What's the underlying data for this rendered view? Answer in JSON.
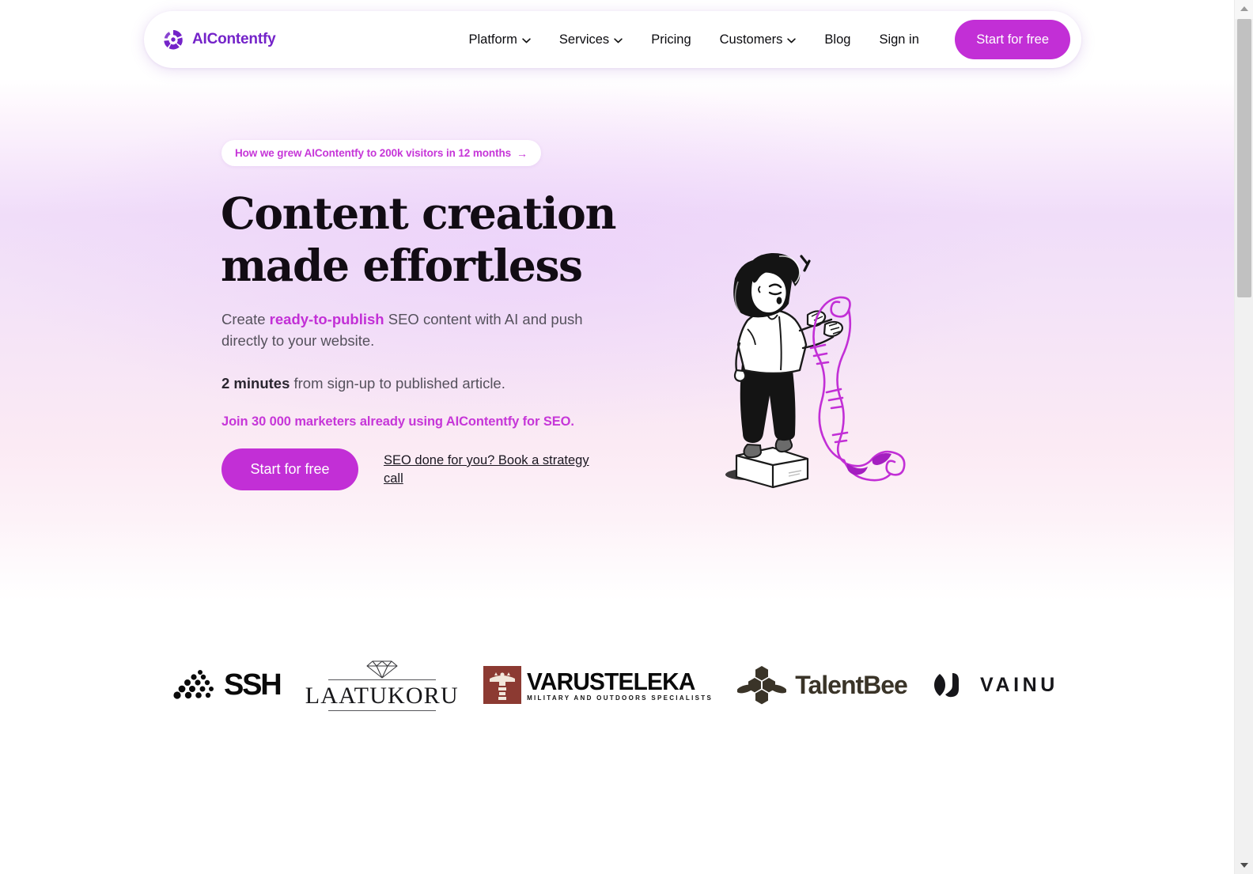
{
  "brand": {
    "name": "AIContentfy",
    "logo_color": "#7423c9",
    "mark_icon": "aicontentfy-circle-logo-icon"
  },
  "header": {
    "nav": [
      {
        "label": "Platform",
        "has_dropdown": true
      },
      {
        "label": "Services",
        "has_dropdown": true
      },
      {
        "label": "Pricing",
        "has_dropdown": false
      },
      {
        "label": "Customers",
        "has_dropdown": true
      },
      {
        "label": "Blog",
        "has_dropdown": false
      },
      {
        "label": "Sign in",
        "has_dropdown": false
      }
    ],
    "cta_label": "Start for free",
    "cta_color": "#c22fd6"
  },
  "hero": {
    "badge": {
      "text": "How we grew AIContentfy to 200k visitors in 12 months",
      "arrow": "→",
      "color": "#c636d8"
    },
    "headline": "Content creation made effortless",
    "lead": {
      "before": "Create ",
      "highlight": "ready-to-publish",
      "after": " SEO content with AI and push directly to your website."
    },
    "sub": {
      "bold": "2 minutes",
      "rest": " from sign-up to published article."
    },
    "join_line": "Join 30 000 marketers already using AIContentfy for SEO.",
    "cta_label": "Start for free",
    "secondary_link": "SEO done for you? Book a strategy call",
    "illustration_name": "woman-holding-long-scroll-illustration"
  },
  "logos": {
    "items": [
      {
        "name": "SSH",
        "icon": "ssh-dot-matrix-icon"
      },
      {
        "name": "LAATUKORU",
        "icon": "diamond-icon"
      },
      {
        "name": "VARUSTELEKA",
        "tagline": "MILITARY AND OUTDOORS SPECIALISTS",
        "icon": "varusteleka-emblem-icon"
      },
      {
        "name": "TalentBee",
        "icon": "honeycomb-bee-icon"
      },
      {
        "name": "VAINU",
        "icon": "vainu-mark-icon"
      }
    ]
  },
  "scrollbar": {
    "up_arrow": "▲",
    "down_arrow": "▼"
  }
}
